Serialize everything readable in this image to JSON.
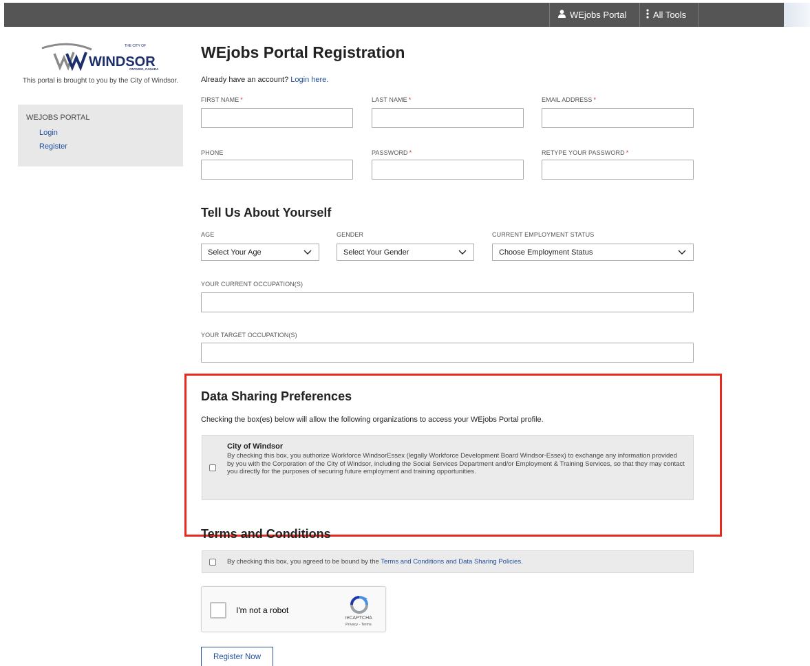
{
  "topbar": {
    "portal_label": "WEjobs Portal",
    "tools_label": "All Tools",
    "user_icon": "user-icon",
    "menu_icon": "vertical-dots-icon"
  },
  "sidebar": {
    "logo_text": "WINDSOR",
    "logo_small_top": "THE CITY OF",
    "logo_small_bottom": "ONTARIO, CANADA",
    "brought_by": "This portal is brought to you by the City of Windsor.",
    "section_title": "WEJOBS PORTAL",
    "links": [
      "Login",
      "Register"
    ]
  },
  "form": {
    "title": "WEjobs Portal Registration",
    "already_text": "Already have an account?",
    "login_link": "Login here.",
    "fields": {
      "first_name": "FIRST NAME",
      "last_name": "LAST NAME",
      "email": "EMAIL ADDRESS",
      "phone": "PHONE",
      "password": "PASSWORD",
      "retype_password": "RETYPE YOUR PASSWORD"
    },
    "required_marker": "*"
  },
  "about": {
    "title": "Tell Us About Yourself",
    "age_label": "AGE",
    "age_value": "Select Your Age",
    "gender_label": "GENDER",
    "gender_value": "Select Your Gender",
    "employment_label": "CURRENT EMPLOYMENT STATUS",
    "employment_value": "Choose Employment Status",
    "current_occupation_label": "YOUR CURRENT OCCUPATION(S)",
    "target_occupation_label": "YOUR TARGET OCCUPATION(S)"
  },
  "sharing": {
    "title": "Data Sharing Preferences",
    "description": "Checking the box(es) below will allow the following organizations to access your WEjobs Portal profile.",
    "org_name": "City of Windsor",
    "org_text": "By checking this box, you authorize Workforce WindsorEssex (legally Workforce Development Board Windsor-Essex) to exchange any information provided by you with the Corporation of the City of Windsor, including the Social Services Department and/or Employment & Training Services, so that they may contact you directly for the purposes of securing future employment and training opportunities.",
    "highlight_color": "#e8291c"
  },
  "terms": {
    "title": "Terms and Conditions",
    "text": "By checking this box, you agreed to be bound by the",
    "link": "Terms and Conditions and Data Sharing Policies."
  },
  "captcha": {
    "label": "I'm not a robot",
    "brand": "reCAPTCHA",
    "privacy_terms": "Privacy - Terms"
  },
  "submit": {
    "label": "Register Now"
  }
}
